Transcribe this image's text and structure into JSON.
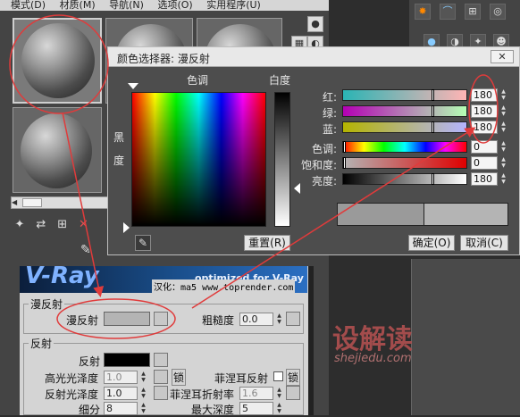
{
  "editor": {
    "menu": [
      "模式(D)",
      "材质(M)",
      "导航(N)",
      "选项(O)",
      "实用程序(U)"
    ]
  },
  "banner": {
    "logo": "V-Ray",
    "tagline": "optimized for V-Ray",
    "credit": "汉化：ma5 www.toprender.com"
  },
  "diffuse_group": {
    "title": "漫反射",
    "diffuse_label": "漫反射",
    "diffuse_color": "#b4b4b4",
    "roughness_label": "粗糙度",
    "roughness_value": "0.0"
  },
  "reflection_group": {
    "title": "反射",
    "reflect_label": "反射",
    "reflect_color": "#000000",
    "hilight_gloss_label": "高光光泽度",
    "hilight_gloss_value": "1.0",
    "lock_label": "锁",
    "fresnel_label": "菲涅耳反射",
    "fresnel_lock_label": "锁",
    "refl_gloss_label": "反射光泽度",
    "refl_gloss_value": "1.0",
    "fresnel_ior_label": "菲涅耳折射率",
    "fresnel_ior_value": "1.6",
    "subdivs_label": "细分",
    "subdivs_value": "8",
    "max_depth_label": "最大深度",
    "max_depth_value": "5"
  },
  "dialog": {
    "title": "颜色选择器: 漫反射",
    "hue_header": "色调",
    "whiteness_header": "白度",
    "blackness_label_1": "黑",
    "blackness_label_2": "度",
    "red_label": "红:",
    "green_label": "绿:",
    "blue_label": "蓝:",
    "hue_label": "色调:",
    "saturation_label": "饱和度:",
    "value_label": "亮度:",
    "red": "180",
    "green": "180",
    "blue": "180",
    "hue": "0",
    "saturation": "0",
    "value": "180",
    "reset_label": "重置(R)",
    "ok_label": "确定(O)",
    "cancel_label": "取消(C)",
    "current_color": "#b4b4b4",
    "original_color": "#9a9a9a"
  },
  "watermark": {
    "main": "设解读",
    "sub": "shejiedu.com"
  },
  "annotation_color": "#e03b3b"
}
